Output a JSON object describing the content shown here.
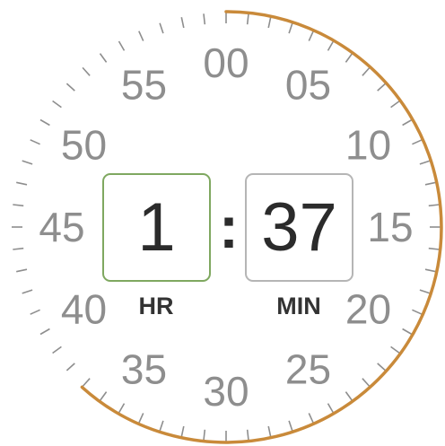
{
  "timer": {
    "hours": "1",
    "minutes": "37",
    "separator": ":",
    "hours_label": "HR",
    "minutes_label": "MIN",
    "selected_minute": 37
  },
  "dial": {
    "numbers": [
      "00",
      "05",
      "10",
      "15",
      "20",
      "25",
      "30",
      "35",
      "40",
      "45",
      "50",
      "55"
    ],
    "tick_count": 60,
    "colors": {
      "progress_arc": "#c98a3a",
      "tick": "#8e8e8e",
      "number": "#8e8e8e",
      "hours_border": "#7fa860",
      "minutes_border": "#b5b5b5"
    }
  }
}
